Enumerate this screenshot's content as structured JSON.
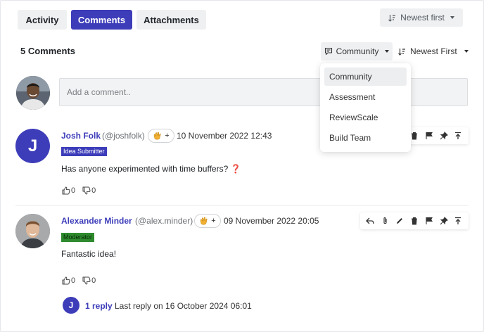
{
  "tabs": [
    {
      "label": "Activity"
    },
    {
      "label": "Comments"
    },
    {
      "label": "Attachments"
    }
  ],
  "top_sort": {
    "label": "Newest first"
  },
  "header": {
    "count_label": "5 Comments",
    "filter_label": "Community",
    "sort_label": "Newest First"
  },
  "filter_menu": {
    "items": [
      {
        "label": "Community"
      },
      {
        "label": "Assessment"
      },
      {
        "label": "ReviewScale"
      },
      {
        "label": "Build Team"
      }
    ]
  },
  "composer": {
    "placeholder": "Add a comment.."
  },
  "comments": [
    {
      "avatar_initial": "J",
      "author": "Josh Folk",
      "handle": "(@joshfolk)",
      "reaction_plus": "+",
      "datetime": "10 November 2022 12:43",
      "badge": "Idea Submitter",
      "text": "Has anyone experimented with time buffers?",
      "emoji": "❓",
      "upvotes": "0",
      "downvotes": "0"
    },
    {
      "author": "Alexander Minder",
      "handle": "(@alex.minder)",
      "reaction_plus": "+",
      "datetime": "09 November 2022 20:05",
      "badge": "Moderator",
      "text": "Fantastic idea!",
      "upvotes": "0",
      "downvotes": "0",
      "reply": {
        "avatar_initial": "J",
        "link": "1 reply",
        "meta": "Last reply on 16 October 2024 06:01"
      }
    }
  ],
  "colors": {
    "accent": "#3d3dba",
    "badge_submitter": "#3d3dba",
    "badge_moderator": "#2e8b2e",
    "tab_inactive_bg": "#eef0f2",
    "dropdown_selected_bg": "#eceef0"
  }
}
